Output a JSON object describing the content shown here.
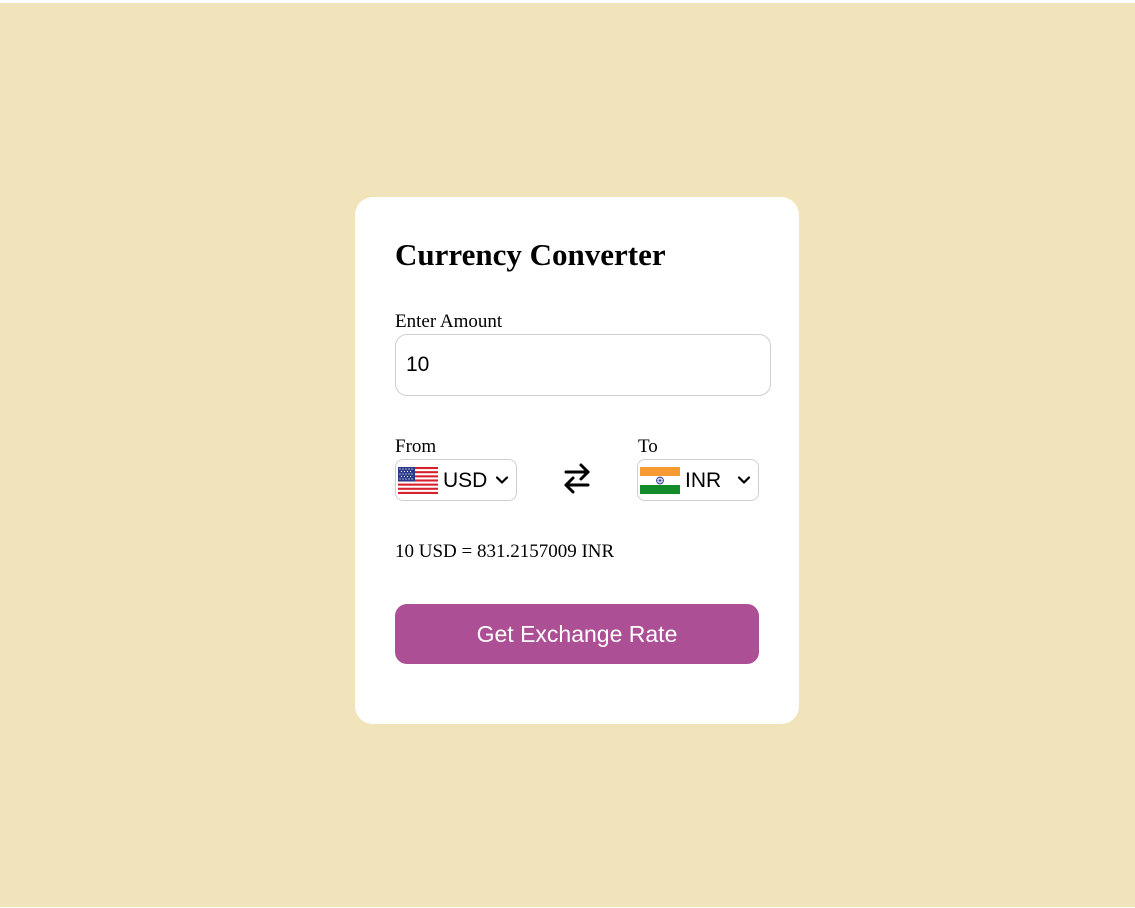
{
  "app": {
    "title": "Currency Converter"
  },
  "amount": {
    "label": "Enter Amount",
    "value": "10"
  },
  "from": {
    "label": "From",
    "currency": "USD",
    "flag_icon": "us-flag-icon"
  },
  "to": {
    "label": "To",
    "currency": "INR",
    "flag_icon": "india-flag-icon"
  },
  "swap": {
    "icon": "swap-arrows-icon"
  },
  "result": {
    "text": "10 USD = 831.2157009 INR"
  },
  "button": {
    "label": "Get Exchange Rate"
  },
  "colors": {
    "background": "#f2e4ba",
    "card": "#ffffff",
    "button": "#ad4f94",
    "button_text": "#ffffff"
  }
}
